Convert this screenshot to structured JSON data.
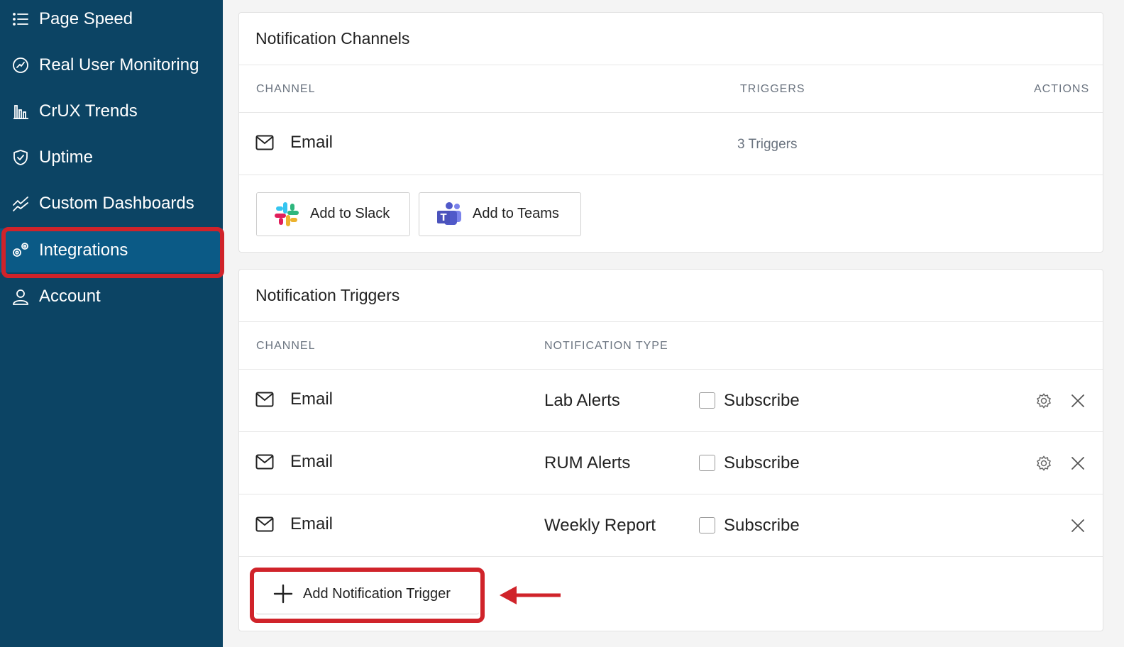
{
  "sidebar": {
    "items": [
      {
        "label": "Page Speed",
        "icon": "list-icon"
      },
      {
        "label": "Real User Monitoring",
        "icon": "gauge-icon"
      },
      {
        "label": "CrUX Trends",
        "icon": "bar-chart-icon"
      },
      {
        "label": "Uptime",
        "icon": "shield-check-icon"
      },
      {
        "label": "Custom Dashboards",
        "icon": "trend-line-icon"
      },
      {
        "label": "Integrations",
        "icon": "gears-icon",
        "active": true
      },
      {
        "label": "Account",
        "icon": "user-icon"
      }
    ]
  },
  "channels_card": {
    "title": "Notification Channels",
    "columns": {
      "channel": "CHANNEL",
      "triggers": "TRIGGERS",
      "actions": "ACTIONS"
    },
    "rows": [
      {
        "channel": "Email",
        "triggers": "3 Triggers"
      }
    ],
    "add_slack_label": "Add to Slack",
    "add_teams_label": "Add to Teams"
  },
  "triggers_card": {
    "title": "Notification Triggers",
    "columns": {
      "channel": "CHANNEL",
      "type": "NOTIFICATION TYPE"
    },
    "rows": [
      {
        "channel": "Email",
        "type": "Lab Alerts",
        "subscribe": "Subscribe",
        "has_settings": true
      },
      {
        "channel": "Email",
        "type": "RUM Alerts",
        "subscribe": "Subscribe",
        "has_settings": true
      },
      {
        "channel": "Email",
        "type": "Weekly Report",
        "subscribe": "Subscribe",
        "has_settings": false
      }
    ],
    "add_trigger_label": "Add Notification Trigger"
  },
  "colors": {
    "sidebar_bg": "#0c4464",
    "sidebar_active": "#0b5a86",
    "highlight": "#d0232a"
  }
}
